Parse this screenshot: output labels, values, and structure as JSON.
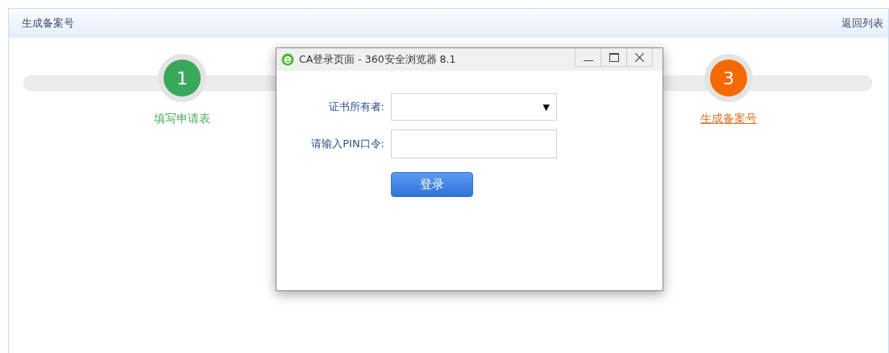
{
  "header": {
    "title": "生成备案号",
    "back_link": "返回列表"
  },
  "steps": [
    {
      "number": "1",
      "label": "填写申请表",
      "current": false
    },
    {
      "number": "3",
      "label": "生成备案号",
      "current": true
    }
  ],
  "dialog": {
    "title": "CA登录页面 - 360安全浏览器 8.1",
    "fields": [
      {
        "kind": "select",
        "label": "证书所有者:",
        "arrow": "▼"
      },
      {
        "kind": "input",
        "label": "请输入PIN口令:"
      }
    ],
    "submit": "登录"
  }
}
